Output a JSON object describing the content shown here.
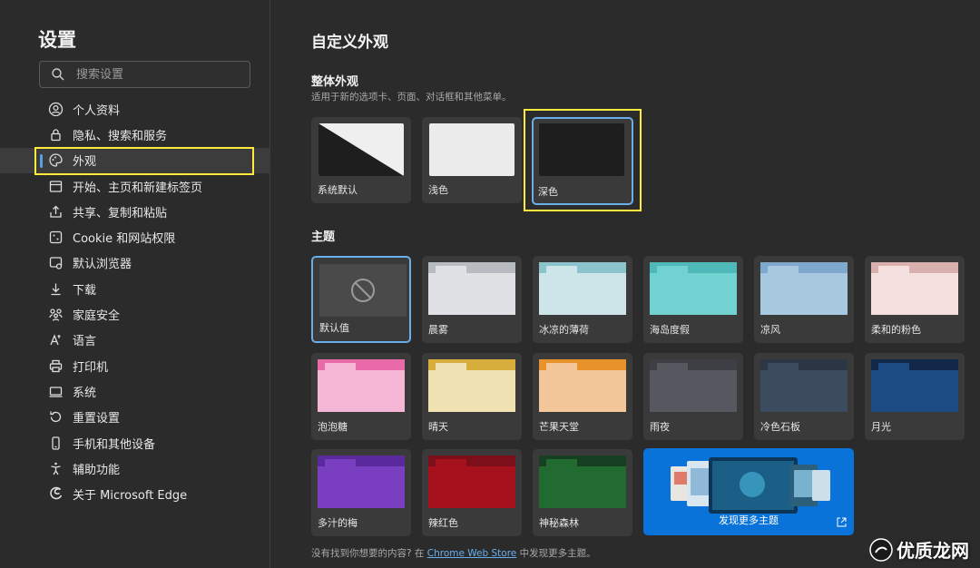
{
  "sidebar": {
    "title": "设置",
    "search_placeholder": "搜索设置",
    "items": [
      {
        "label": "个人资料",
        "icon": "profile-icon"
      },
      {
        "label": "隐私、搜索和服务",
        "icon": "lock-icon"
      },
      {
        "label": "外观",
        "icon": "palette-icon",
        "active": true
      },
      {
        "label": "开始、主页和新建标签页",
        "icon": "home-tab-icon"
      },
      {
        "label": "共享、复制和粘贴",
        "icon": "share-icon"
      },
      {
        "label": "Cookie 和网站权限",
        "icon": "cookie-icon"
      },
      {
        "label": "默认浏览器",
        "icon": "browser-icon"
      },
      {
        "label": "下载",
        "icon": "download-icon"
      },
      {
        "label": "家庭安全",
        "icon": "family-icon"
      },
      {
        "label": "语言",
        "icon": "language-icon"
      },
      {
        "label": "打印机",
        "icon": "printer-icon"
      },
      {
        "label": "系统",
        "icon": "system-icon"
      },
      {
        "label": "重置设置",
        "icon": "reset-icon"
      },
      {
        "label": "手机和其他设备",
        "icon": "phone-icon"
      },
      {
        "label": "辅助功能",
        "icon": "accessibility-icon"
      },
      {
        "label": "关于 Microsoft Edge",
        "icon": "edge-icon"
      }
    ]
  },
  "main": {
    "title": "自定义外观",
    "overall": {
      "title": "整体外观",
      "desc": "适用于新的选项卡、页面、对话框和其他菜单。",
      "options": [
        {
          "label": "系统默认"
        },
        {
          "label": "浅色"
        },
        {
          "label": "深色",
          "selected": true
        }
      ]
    },
    "themes": {
      "title": "主题",
      "items": [
        {
          "label": "默认值",
          "selected": true,
          "tab": "#4a4a4a",
          "body": "#4a4a4a",
          "default": true
        },
        {
          "label": "晨雾",
          "tab": "#b8bcc2",
          "body": "#dfe1e5"
        },
        {
          "label": "冰凉的薄荷",
          "tab": "#8bc4cc",
          "body": "#cde5e9"
        },
        {
          "label": "海岛度假",
          "tab": "#4fb8b8",
          "body": "#72d2d2"
        },
        {
          "label": "凉风",
          "tab": "#7fa9cc",
          "body": "#a8c8e0"
        },
        {
          "label": "柔和的粉色",
          "tab": "#d9b0ae",
          "body": "#f3e0df"
        },
        {
          "label": "泡泡糖",
          "tab": "#e86aa8",
          "body": "#f6b6d6"
        },
        {
          "label": "晴天",
          "tab": "#d7ae3c",
          "body": "#f1e2b3"
        },
        {
          "label": "芒果天堂",
          "tab": "#e8922c",
          "body": "#f3c79a"
        },
        {
          "label": "雨夜",
          "tab": "#3d3f44",
          "body": "#55585e"
        },
        {
          "label": "冷色石板",
          "tab": "#2c3644",
          "body": "#3d4b5e"
        },
        {
          "label": "月光",
          "tab": "#11284a",
          "body": "#1c4a82"
        },
        {
          "label": "多汁的梅",
          "tab": "#5a2a9c",
          "body": "#7a3fc0"
        },
        {
          "label": "辣红色",
          "tab": "#7c0f1a",
          "body": "#a5121e"
        },
        {
          "label": "神秘森林",
          "tab": "#173f22",
          "body": "#226b30"
        }
      ],
      "discover_label": "发现更多主题"
    },
    "footer": {
      "prefix": "没有找到你想要的内容? 在",
      "link": "Chrome Web Store",
      "suffix": "中发现更多主题。"
    }
  },
  "watermark": "优质龙网"
}
